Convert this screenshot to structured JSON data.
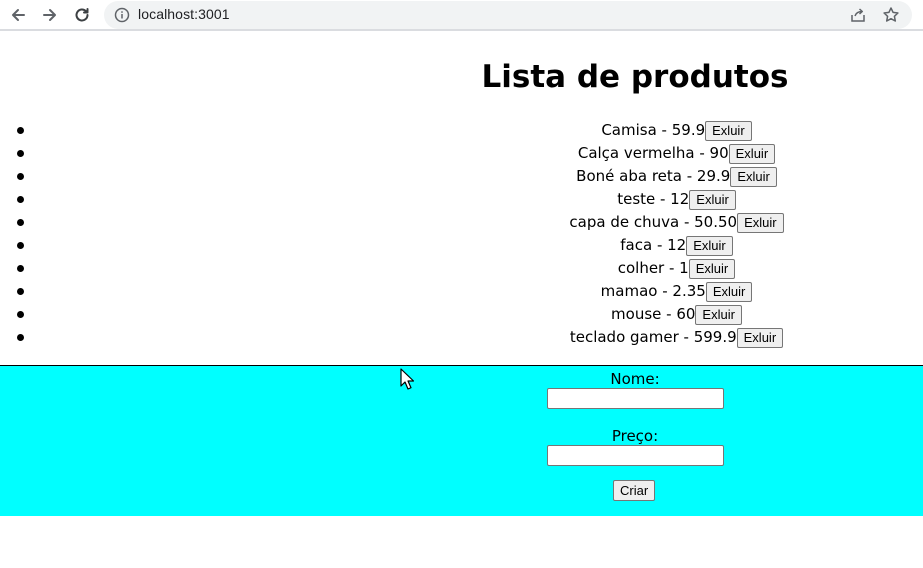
{
  "browser": {
    "url": "localhost:3001"
  },
  "page": {
    "title": "Lista de produtos",
    "products": [
      {
        "label": "Camisa - 59.9",
        "delete": "Exluir"
      },
      {
        "label": "Calça vermelha - 90",
        "delete": "Exluir"
      },
      {
        "label": "Boné aba reta - 29.9",
        "delete": "Exluir"
      },
      {
        "label": "teste - 12",
        "delete": "Exluir"
      },
      {
        "label": "capa de chuva - 50.50",
        "delete": "Exluir"
      },
      {
        "label": "faca - 12",
        "delete": "Exluir"
      },
      {
        "label": "colher - 1",
        "delete": "Exluir"
      },
      {
        "label": "mamao - 2.35",
        "delete": "Exluir"
      },
      {
        "label": "mouse - 60",
        "delete": "Exluir"
      },
      {
        "label": "teclado gamer - 599.9",
        "delete": "Exluir"
      }
    ],
    "form": {
      "name_label": "Nome:",
      "name_value": "",
      "price_label": "Preço:",
      "price_value": "",
      "submit_label": "Criar"
    }
  },
  "colors": {
    "form_background": "#00ffff"
  }
}
